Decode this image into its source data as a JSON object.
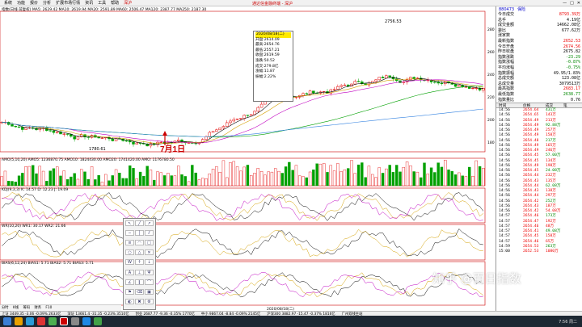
{
  "menu": {
    "items": [
      "系统",
      "功能",
      "报价",
      "分析",
      "扩展市场行情",
      "资讯",
      "工具",
      "帮助"
    ],
    "tab_label": "深沪",
    "page_title": "通达信金融终端 - 深沪"
  },
  "window_controls": [
    "—",
    "□",
    "✕"
  ],
  "main_chart": {
    "indicator_line": "指数(日线 前复权)  MA5: 2629.42  MA10: 2619.94  MA20: 2591.89  MA60: 2506.47  MA120: 2387.77  MA250: 2187.30",
    "price_high_label": "2756.53",
    "price_low_label": "1780.61",
    "annotation": "7月1日",
    "date_label": "2020/08/18(二)",
    "bottom_date": "2020/08/18(二)",
    "tooltip": {
      "header": "2020/08/18(二)",
      "rows": [
        "开盘:2614.09",
        "最高:2654.76",
        "最低:2557.21",
        "收盘:2619.59",
        "涨跌:50.52",
        "成交:279.8亿",
        "涨幅:11.87",
        "振幅:2.22%"
      ]
    },
    "ticks_right": [
      "2800",
      "2600",
      "2400",
      "2200",
      "2000",
      "1800"
    ]
  },
  "sub_panels": [
    {
      "name": "vol",
      "label": "AMO(5,10,20)  AMO5: 1236870.75  AMO10: 1824430.00  AMO20: 1741420.00  AMO: 1176780.50",
      "ticks": [
        "30000",
        "20000",
        "10000"
      ]
    },
    {
      "name": "kdj",
      "label": "KDJ(9,3,3)  K: 14.57  D: 12.23  J: 19.09",
      "ticks": [
        "80",
        "50",
        "20"
      ]
    },
    {
      "name": "wr",
      "label": "WR(10,20)  WR1: 30.17  WR2: 21.66",
      "ticks": [
        "80",
        "40",
        "20"
      ]
    },
    {
      "name": "bias",
      "label": "BIAS(6,12,24)  BIAS1: 5.71  BIAS2: 5.71  BIAS3: 5.71",
      "ticks": [
        "10",
        "0",
        "-10"
      ]
    }
  ],
  "right_panel": {
    "code": "880473",
    "name": "保险",
    "quotes": [
      {
        "label": "今日成交",
        "value": "8793.39万",
        "color": "red"
      },
      {
        "label": "总手",
        "value": "4.19亿",
        "color": ""
      },
      {
        "label": "成交金额",
        "value": "14662.08亿",
        "color": ""
      },
      {
        "label": "委比",
        "value": "677.62万",
        "color": ""
      },
      {
        "label": "涨家数",
        "value": "",
        "color": ""
      },
      {
        "label": "最新指数",
        "value": "2652.53",
        "color": "red"
      },
      {
        "label": "今日开盘",
        "value": "2674.56",
        "color": "red"
      },
      {
        "label": "昨日收盘",
        "value": "2675.82",
        "color": ""
      },
      {
        "label": "指数涨跌",
        "value": "-23.29",
        "color": "grn"
      },
      {
        "label": "指数涨幅",
        "value": "-0.87%",
        "color": "grn"
      },
      {
        "label": "平均涨幅",
        "value": "-0.75%",
        "color": "grn"
      },
      {
        "label": "指数振幅",
        "value": "49.95/1.83%",
        "color": ""
      },
      {
        "label": "总成交额",
        "value": "123.08亿",
        "color": ""
      },
      {
        "label": "总成交量",
        "value": "3079513万",
        "color": ""
      },
      {
        "label": "最高指数",
        "value": "2683.17",
        "color": "red"
      },
      {
        "label": "最低指数",
        "value": "2638.77",
        "color": "grn"
      },
      {
        "label": "指数量比",
        "value": "0.76",
        "color": ""
      }
    ],
    "trades_header": [
      "时间",
      "价格",
      "成交",
      "笔"
    ],
    "trades": [
      [
        "14:56",
        "2654.64",
        "431万",
        ""
      ],
      [
        "14:56",
        "2654.65",
        "143万",
        ""
      ],
      [
        "14:56",
        "2654.49",
        "213万",
        ""
      ],
      [
        "14:56",
        "2654.49",
        "92.88万",
        ""
      ],
      [
        "14:56",
        "2654.49",
        "257万",
        ""
      ],
      [
        "14:56",
        "2654.49",
        "158万",
        ""
      ],
      [
        "14:56",
        "2654.48",
        "217万",
        ""
      ],
      [
        "14:56",
        "2654.49",
        "165万",
        ""
      ],
      [
        "14:56",
        "2654.49",
        "246万",
        ""
      ],
      [
        "14:56",
        "2654.45",
        "57.00万",
        ""
      ],
      [
        "14:56",
        "2654.45",
        "134万",
        ""
      ],
      [
        "14:56",
        "2654.49",
        "198万",
        ""
      ],
      [
        "14:56",
        "2654.45",
        "24.08万",
        ""
      ],
      [
        "14:56",
        "2654.44",
        "232万",
        ""
      ],
      [
        "14:56",
        "2654.43",
        "135万",
        ""
      ],
      [
        "14:56",
        "2654.44",
        "62.08万",
        ""
      ],
      [
        "14:56",
        "2654.43",
        "138万",
        ""
      ],
      [
        "14:56",
        "2654.44",
        "297万",
        ""
      ],
      [
        "14:56",
        "2654.42",
        "252万",
        ""
      ],
      [
        "14:56",
        "2654.43",
        "187万",
        ""
      ],
      [
        "14:56",
        "2654.42",
        "54.08万",
        ""
      ],
      [
        "14:57",
        "2654.46",
        "173万",
        ""
      ],
      [
        "14:57",
        "2654.47",
        "192万",
        ""
      ],
      [
        "14:57",
        "2654.46",
        "48万",
        ""
      ],
      [
        "14:57",
        "2654.41",
        "49.08万",
        ""
      ],
      [
        "14:57",
        "2654.45",
        "158万",
        ""
      ],
      [
        "14:57",
        "2654.46",
        "65万",
        ""
      ],
      [
        "14:59",
        "2654.53",
        "263万",
        ""
      ],
      [
        "15:00",
        "2652.53",
        "1080万",
        ""
      ]
    ]
  },
  "bottom_tabs": [
    "分时",
    "K线",
    "筹码",
    "财务",
    "F10"
  ],
  "statusbar": [
    "上证 3449.35 -3.06 -0.09% 2633亿",
    "深证 13661.4 -31.35 -0.23% 3510亿",
    "创业 2687.77 -9.36 -0.35% 1770亿",
    "中小 9867.04 -8.84 -0.09% 2145亿",
    "沪深300 3882.97 -15.47 -0.37% 1816亿",
    "广州双线主站"
  ],
  "watermark": "知乎 @百日指数",
  "taskbar_clock": "7:56 周二",
  "colors": {
    "up": "#e40000",
    "down": "#00a000",
    "ma5": "#000000",
    "ma10": "#d4a000",
    "ma20": "#c000c0",
    "ma60": "#00a000",
    "ma120": "#3080e0",
    "ma250": "#2fa070"
  }
}
